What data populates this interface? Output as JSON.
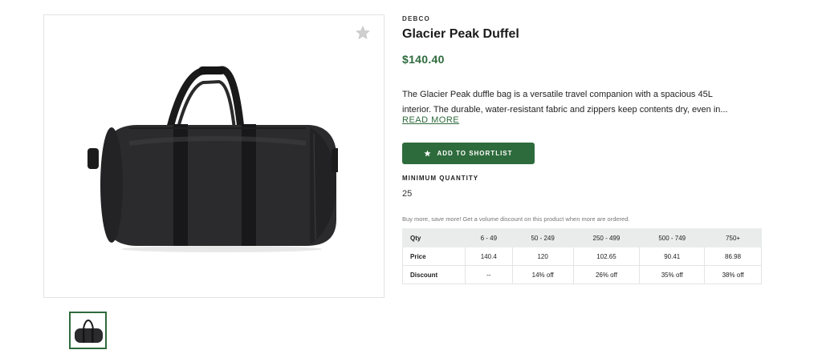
{
  "product": {
    "brand": "DEBCO",
    "title": "Glacier Peak Duffel",
    "price": "$140.40",
    "description_line1": "The Glacier Peak duffle bag is a versatile travel companion with a spacious 45L",
    "description_line2": "interior. The durable, water-resistant fabric and zippers keep contents dry, even in...",
    "read_more": "READ MORE",
    "accent_color": "#2e6b3c"
  },
  "actions": {
    "shortlist_label": "ADD TO SHORTLIST",
    "favorite_icon": "star-icon"
  },
  "minimum_quantity": {
    "label": "MINIMUM QUANTITY",
    "value": "25"
  },
  "volume_discount": {
    "note": "Buy more, save more! Get a volume discount on this product when more are ordered.",
    "rows": [
      {
        "label": "Qty",
        "cells": [
          "6 - 49",
          "50 - 249",
          "250 - 499",
          "500 - 749",
          "750+"
        ]
      },
      {
        "label": "Price",
        "cells": [
          "140.4",
          "120",
          "102.65",
          "90.41",
          "86.98"
        ]
      },
      {
        "label": "Discount",
        "cells": [
          "--",
          "14% off",
          "26% off",
          "35% off",
          "38% off"
        ]
      }
    ]
  }
}
